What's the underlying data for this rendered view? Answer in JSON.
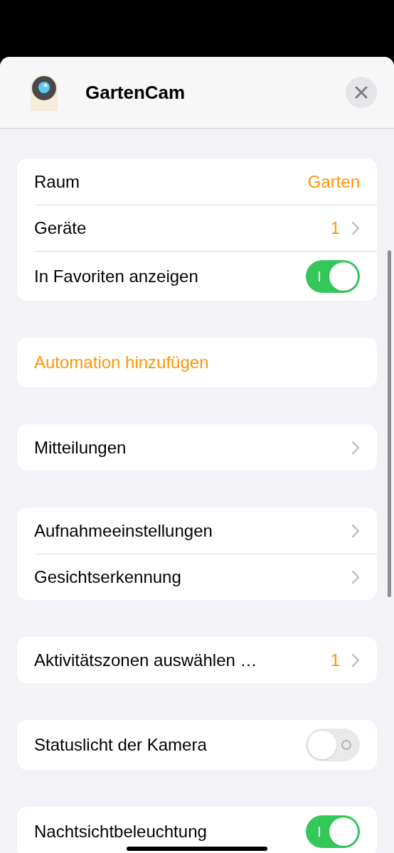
{
  "header": {
    "title": "GartenCam"
  },
  "groups": [
    {
      "rows": [
        {
          "kind": "value",
          "label": "Raum",
          "value": "Garten"
        },
        {
          "kind": "nav",
          "label": "Geräte",
          "value": "1"
        },
        {
          "kind": "toggle",
          "label": "In Favoriten anzeigen",
          "on": true
        }
      ]
    },
    {
      "rows": [
        {
          "kind": "action",
          "label": "Automation hinzufügen"
        }
      ]
    },
    {
      "rows": [
        {
          "kind": "nav",
          "label": "Mitteilungen"
        }
      ]
    },
    {
      "rows": [
        {
          "kind": "nav",
          "label": "Aufnahmeeinstellungen"
        },
        {
          "kind": "nav",
          "label": "Gesichtserkennung"
        }
      ]
    },
    {
      "rows": [
        {
          "kind": "nav",
          "label": "Aktivitätszonen auswählen …",
          "value": "1"
        }
      ]
    },
    {
      "rows": [
        {
          "kind": "toggle",
          "label": "Statuslicht der Kamera",
          "on": false
        }
      ]
    },
    {
      "rows": [
        {
          "kind": "toggle",
          "label": "Nachtsichtbeleuchtung",
          "on": true
        }
      ]
    }
  ]
}
